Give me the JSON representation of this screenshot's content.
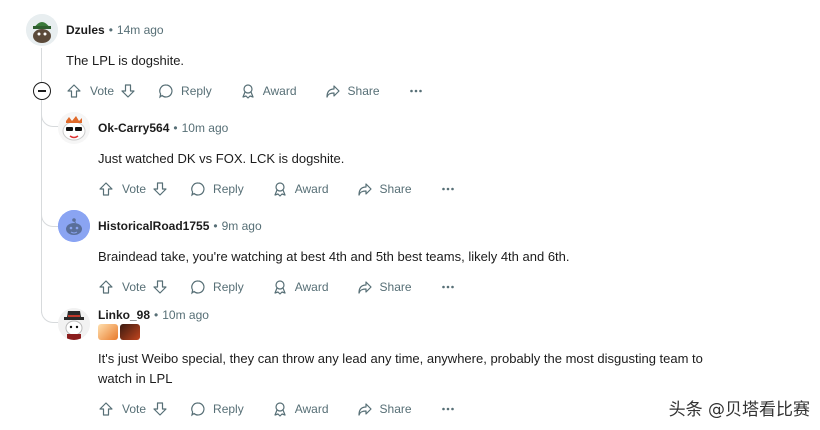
{
  "comments": [
    {
      "user": "Dzules",
      "time": "14m ago",
      "text": "The LPL is dogshite.",
      "actions": {
        "vote": "Vote",
        "reply": "Reply",
        "award": "Award",
        "share": "Share"
      }
    },
    {
      "user": "Ok-Carry564",
      "time": "10m ago",
      "text": "Just watched DK vs FOX. LCK is dogshite.",
      "actions": {
        "vote": "Vote",
        "reply": "Reply",
        "award": "Award",
        "share": "Share"
      }
    },
    {
      "user": "HistoricalRoad1755",
      "time": "9m ago",
      "text": "Braindead take, you're watching at best 4th and 5th best teams, likely 4th and 6th.",
      "actions": {
        "vote": "Vote",
        "reply": "Reply",
        "award": "Award",
        "share": "Share"
      }
    },
    {
      "user": "Linko_98",
      "time": "10m ago",
      "text_line1": "It's just Weibo special, they can throw any lead any time, anywhere, probably the most disgusting team to",
      "text_line2": "watch in LPL",
      "actions": {
        "vote": "Vote",
        "reply": "Reply",
        "award": "Award",
        "share": "Share"
      }
    }
  ],
  "separator": "•",
  "watermark": "头条 @贝塔看比赛",
  "colors": {
    "meta": "#576f76",
    "thread": "#d7dadc",
    "text": "#1c1c1c"
  }
}
